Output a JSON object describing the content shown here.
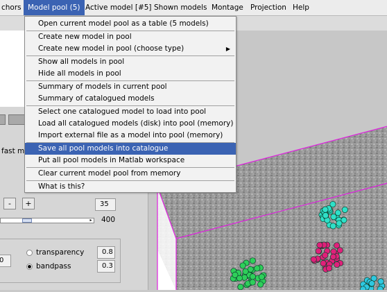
{
  "menubar": {
    "items": [
      "chors",
      "Model pool (5)",
      "Active model [#5]",
      "Shown models",
      "Montage",
      "Projection",
      "Help"
    ],
    "active_index": 1
  },
  "dropdown": {
    "items": [
      "Open current model pool as a table (5 models)",
      "Create new model in pool",
      "Create new model in pool (choose type)",
      "Show all models in pool",
      "Hide all models in pool",
      "Summary of models in current pool",
      "Summary of catalogued models",
      "Select one catalogued model to load into pool",
      "Load all catalogued models (disk) into pool (memory)",
      "Import external file as a model into pool (memory)",
      "Save all pool models into catalogue",
      "Put all pool models in Matlab workspace",
      "Clear current model pool from memory",
      "What is this?"
    ],
    "highlighted_index": 10,
    "submenu_item_index": 2
  },
  "left_panel": {
    "fast_label": "fast m",
    "minus_label": "-",
    "plus_label": "+",
    "value_top": "35",
    "value_slider": "400",
    "slider_level": 0.28,
    "transparency_label": "transparency",
    "transparency_value": "0.8",
    "bandpass_label": "bandpass",
    "bandpass_value": "0.3",
    "left_field_value": "0",
    "bandpass_selected": true
  },
  "viewer": {
    "box_color": "#e020e0",
    "model_colors": [
      "#2ee0c8",
      "#e0207a",
      "#2ecf5a",
      "#2ec8e0"
    ]
  }
}
